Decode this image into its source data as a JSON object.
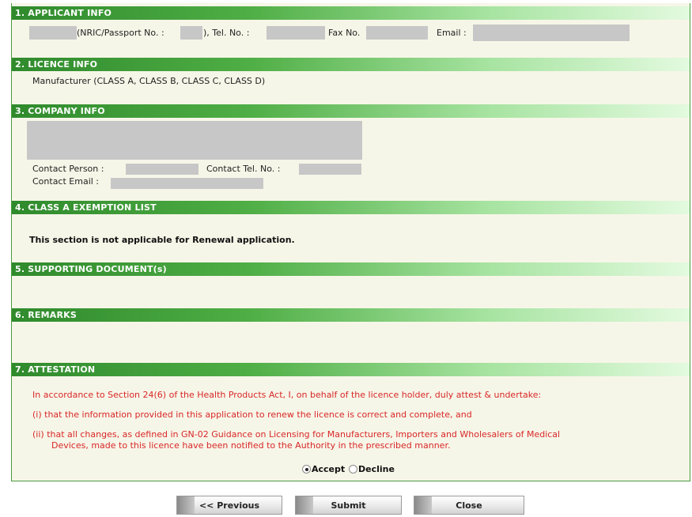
{
  "sections": {
    "s1": "1. APPLICANT INFO",
    "s2": "2. LICENCE INFO",
    "s3": "3. COMPANY INFO",
    "s4": "4. CLASS A EXEMPTION LIST",
    "s5": "5. SUPPORTING DOCUMENT(s)",
    "s6": "6. REMARKS",
    "s7": "7. ATTESTATION"
  },
  "applicant": {
    "nric_label": "(NRIC/Passport No. :",
    "tel_label": "), Tel. No. :",
    "fax_label": "Fax No.",
    "email_label": "Email :"
  },
  "licence": {
    "text": "Manufacturer (CLASS A, CLASS B, CLASS C, CLASS D)"
  },
  "company": {
    "contact_person_label": "Contact Person :",
    "contact_tel_label": "Contact Tel. No. :",
    "contact_email_label": "Contact Email :"
  },
  "exemption": {
    "note": "This section is not applicable for Renewal application."
  },
  "attestation": {
    "intro": "In accordance to Section 24(6) of the Health Products Act, I, on behalf of the licence holder, duly attest & undertake:",
    "item1": "(i)  that the information provided in this application to renew the licence is correct and complete, and",
    "item2_line1": "(ii)  that all changes, as defined in GN-02 Guidance on Licensing for Manufacturers, Importers and Wholesalers of Medical",
    "item2_line2": "Devices, made to this licence have been notified to the Authority in the prescribed manner.",
    "accept_label": "Accept",
    "decline_label": "Decline",
    "selected": "Accept"
  },
  "buttons": {
    "previous": "<< Previous",
    "submit": "Submit",
    "close": "Close"
  }
}
